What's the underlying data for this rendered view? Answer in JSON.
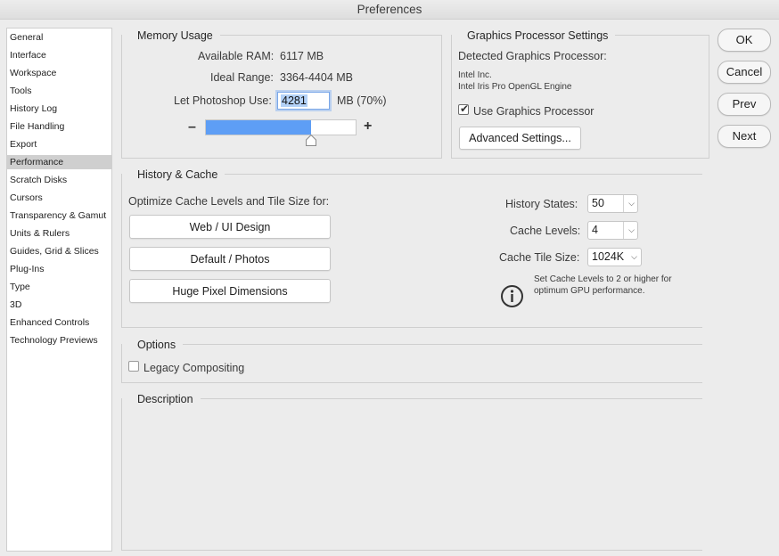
{
  "window": {
    "title": "Preferences"
  },
  "sidebar": {
    "items": [
      {
        "label": "General"
      },
      {
        "label": "Interface"
      },
      {
        "label": "Workspace"
      },
      {
        "label": "Tools"
      },
      {
        "label": "History Log"
      },
      {
        "label": "File Handling"
      },
      {
        "label": "Export"
      },
      {
        "label": "Performance",
        "selected": true
      },
      {
        "label": "Scratch Disks"
      },
      {
        "label": "Cursors"
      },
      {
        "label": "Transparency & Gamut"
      },
      {
        "label": "Units & Rulers"
      },
      {
        "label": "Guides, Grid & Slices"
      },
      {
        "label": "Plug-Ins"
      },
      {
        "label": "Type"
      },
      {
        "label": "3D"
      },
      {
        "label": "Enhanced Controls"
      },
      {
        "label": "Technology Previews"
      }
    ]
  },
  "memory": {
    "title": "Memory Usage",
    "available_label": "Available RAM:",
    "available_value": "6117 MB",
    "ideal_label": "Ideal Range:",
    "ideal_value": "3364-4404 MB",
    "let_label": "Let Photoshop Use:",
    "let_value": "4281",
    "let_suffix": "MB (70%)",
    "slider_fraction": 0.7,
    "minus": "–",
    "plus": "+",
    "slider_color": "#5e9ef5"
  },
  "gpu": {
    "title": "Graphics Processor Settings",
    "detected_label": "Detected Graphics Processor:",
    "vendor": "Intel Inc.",
    "engine": "Intel Iris Pro OpenGL Engine",
    "use_label": "Use Graphics Processor",
    "use_checked": true,
    "advanced_label": "Advanced Settings..."
  },
  "actions": {
    "ok": "OK",
    "cancel": "Cancel",
    "prev": "Prev",
    "next": "Next"
  },
  "history": {
    "title": "History & Cache",
    "optimize_label": "Optimize Cache Levels and Tile Size for:",
    "btn_web": "Web / UI Design",
    "btn_default": "Default / Photos",
    "btn_huge": "Huge Pixel Dimensions",
    "states_label": "History States:",
    "states_value": "50",
    "levels_label": "Cache Levels:",
    "levels_value": "4",
    "tile_label": "Cache Tile Size:",
    "tile_value": "1024K",
    "info_line1": "Set Cache Levels to 2 or higher for",
    "info_line2": "optimum GPU performance.",
    "info_icon": "info-icon"
  },
  "options": {
    "title": "Options",
    "legacy_label": "Legacy Compositing",
    "legacy_checked": false
  },
  "description": {
    "title": "Description"
  }
}
